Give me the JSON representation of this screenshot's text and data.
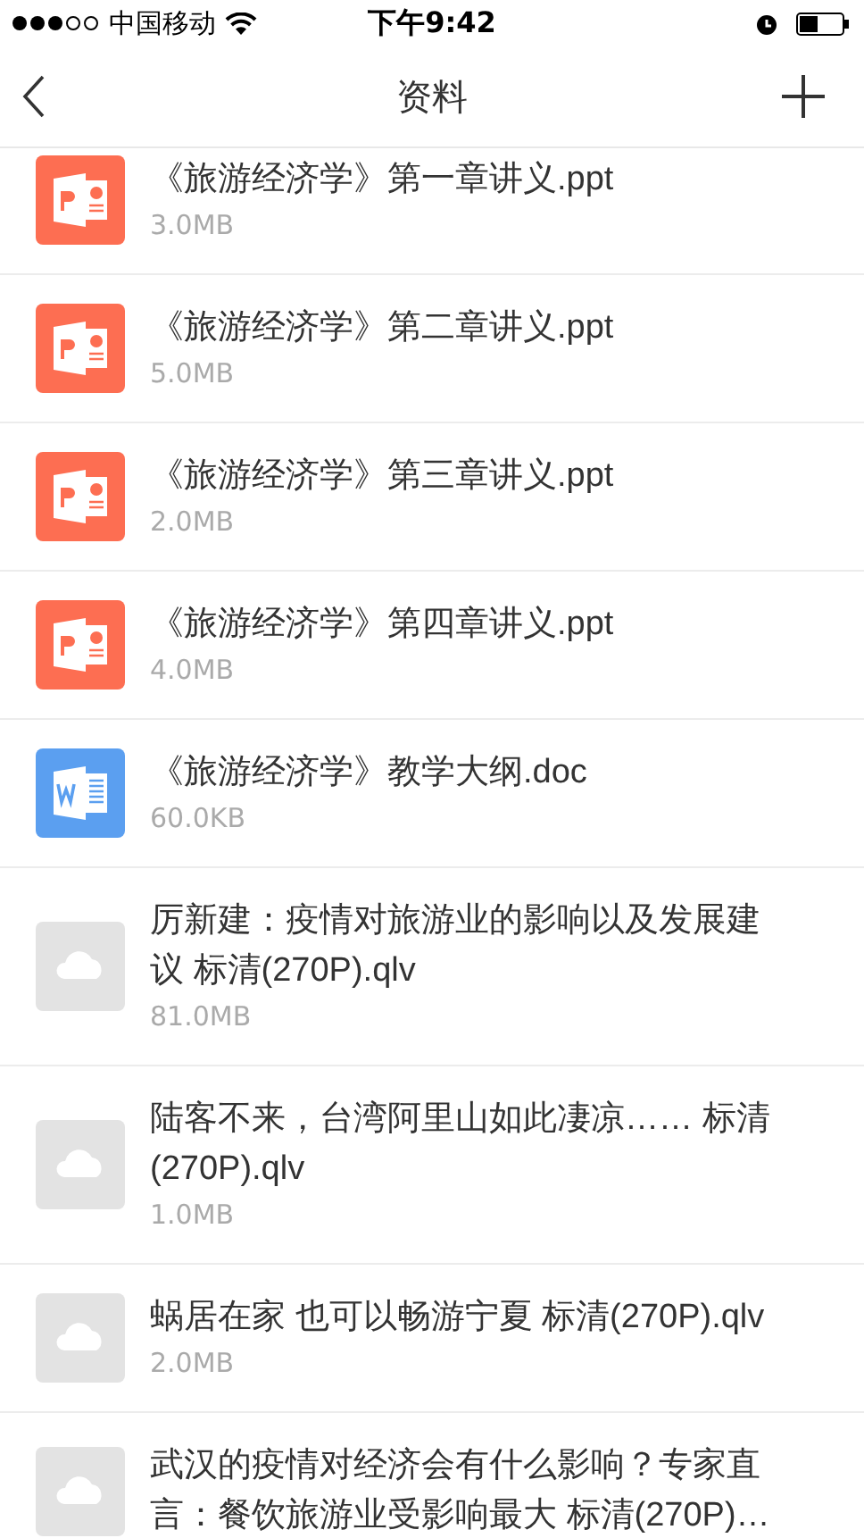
{
  "status_bar": {
    "carrier": "中国移动",
    "time": "下午9:42"
  },
  "nav": {
    "title": "资料"
  },
  "files": [
    {
      "kind": "ppt",
      "name": "《旅游经济学》第一章讲义.ppt",
      "size": "3.0MB"
    },
    {
      "kind": "ppt",
      "name": "《旅游经济学》第二章讲义.ppt",
      "size": "5.0MB"
    },
    {
      "kind": "ppt",
      "name": "《旅游经济学》第三章讲义.ppt",
      "size": "2.0MB"
    },
    {
      "kind": "ppt",
      "name": "《旅游经济学》第四章讲义.ppt",
      "size": "4.0MB"
    },
    {
      "kind": "doc",
      "name": "《旅游经济学》教学大纲.doc",
      "size": "60.0KB"
    },
    {
      "kind": "video",
      "name": "厉新建：疫情对旅游业的影响以及发展建议 标清(270P).qlv",
      "size": "81.0MB"
    },
    {
      "kind": "video",
      "name": "陆客不来，台湾阿里山如此凄凉…… 标清(270P).qlv",
      "size": "1.0MB"
    },
    {
      "kind": "video",
      "name": "蜗居在家 也可以畅游宁夏 标清(270P).qlv",
      "size": "2.0MB"
    },
    {
      "kind": "video",
      "name": "武汉的疫情对经济会有什么影响？专家直言：餐饮旅游业受影响最大 标清(270P)…"
    }
  ]
}
